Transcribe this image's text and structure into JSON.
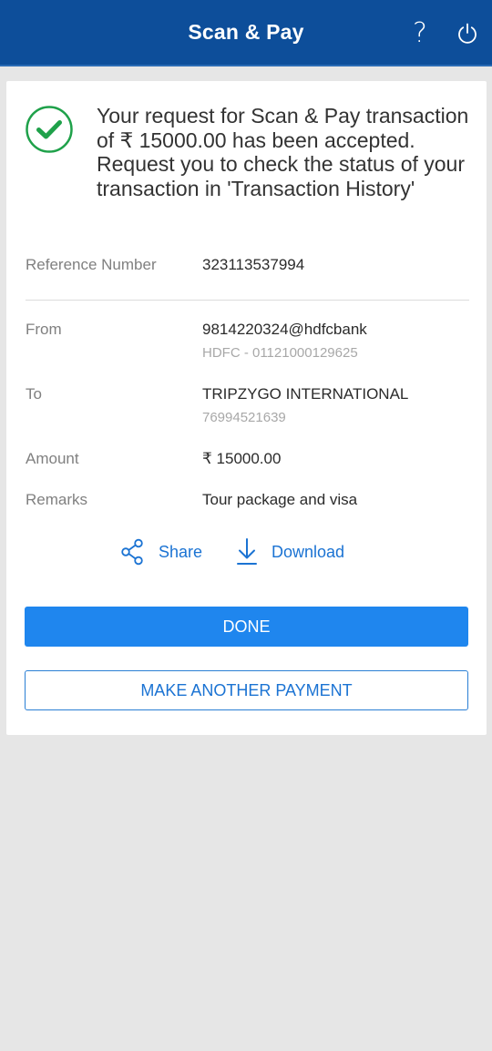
{
  "header": {
    "title": "Scan & Pay",
    "help_icon": "?",
    "power_icon": "power-icon"
  },
  "status": {
    "icon": "check-circle-icon",
    "color": "#1fa14a",
    "message": "Your request for Scan & Pay transaction of ₹ 15000.00 has been accepted. Request you to check the status of your transaction in 'Transaction History'"
  },
  "details": {
    "reference": {
      "label": "Reference Number",
      "value": "323113537994"
    },
    "from": {
      "label": "From",
      "value": "9814220324@hdfcbank",
      "sub": "HDFC - 01121000129625"
    },
    "to": {
      "label": "To",
      "value": "TRIPZYGO INTERNATIONAL",
      "sub": "76994521639"
    },
    "amount": {
      "label": "Amount",
      "value": "₹ 15000.00"
    },
    "remarks": {
      "label": "Remarks",
      "value": "Tour package and visa"
    }
  },
  "actions": {
    "share_label": "Share",
    "download_label": "Download",
    "done_label": "DONE",
    "another_label": "MAKE ANOTHER PAYMENT"
  },
  "colors": {
    "header_bg": "#0d4e9a",
    "accent": "#1f86ee",
    "link": "#1b73d3",
    "success": "#1fa14a"
  }
}
